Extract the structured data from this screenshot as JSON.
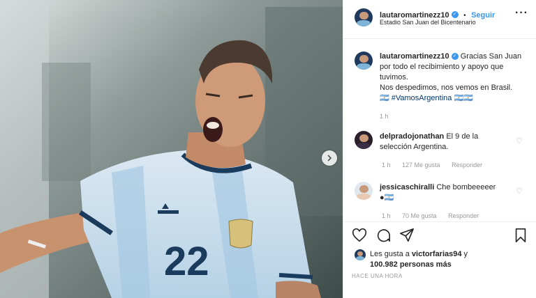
{
  "post": {
    "username": "lautaromartinezz10",
    "follow_label": "Seguir",
    "separator": "•",
    "location": "Estadio San Juan del Bicentenario",
    "caption_line1": "Gracias San Juan por todo el recibimiento y apoyo que tuvimos.",
    "caption_line2": "Nos despedimos, nos vemos en Brasil.",
    "caption_prefix": "🇦🇷",
    "hashtag": "#VamosArgentina",
    "caption_suffix": "🇦🇷🇦🇷",
    "caption_time": "1 h",
    "jersey_number": "22"
  },
  "comments": [
    {
      "username": "delpradojonathan",
      "text": "El 9 de la selección Argentina.",
      "time": "1 h",
      "likes": "127 Me gusta",
      "reply": "Responder"
    },
    {
      "username": "jessicaschiralli",
      "text": "Che bombeeeeer",
      "extra": "●🇦🇷",
      "time": "1 h",
      "likes": "70 Me gusta",
      "reply": "Responder"
    }
  ],
  "likes": {
    "prefix": "Les gusta a",
    "user": "victorfarias94",
    "conj": "y",
    "others": "100.982 personas más"
  },
  "timestamp": "HACE UNA HORA",
  "icons": {
    "verified": "verified-badge-icon",
    "heart": "heart-icon",
    "comment": "comment-icon",
    "share": "share-icon",
    "bookmark": "bookmark-icon",
    "more": "more-options-icon",
    "next": "chevron-right-icon"
  },
  "colors": {
    "accent": "#3897f0",
    "hashtag": "#003569",
    "muted": "#999999",
    "text": "#262626"
  }
}
